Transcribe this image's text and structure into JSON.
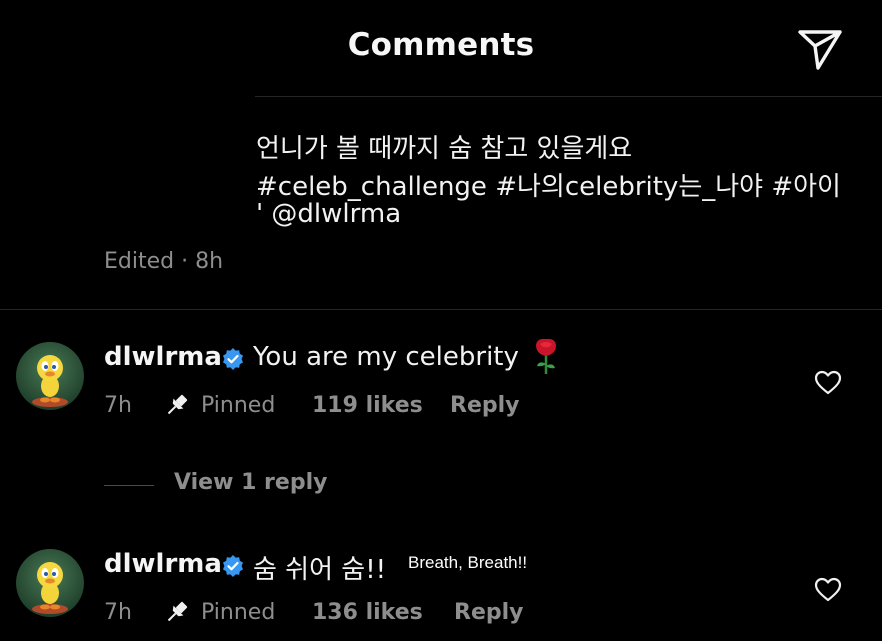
{
  "header": {
    "title": "Comments",
    "share_icon": "send-icon"
  },
  "caption": {
    "line1": "언니가 볼 때까지 숨 참고 있을게요",
    "line2": "#celeb_challenge #나의celebrity는_나야  #아이",
    "line3": "' @dlwlrma",
    "edited": "Edited · 8h"
  },
  "comments": [
    {
      "username": "dlwlrma",
      "text": "You are my celebrity",
      "emoji": "rose-emoji",
      "time": "7h",
      "pinned": "Pinned",
      "likes": "119 likes",
      "reply": "Reply"
    },
    {
      "username": "dlwlrma",
      "text": "숨 쉬어 숨!!",
      "time": "7h",
      "pinned": "Pinned",
      "likes": "136 likes",
      "reply": "Reply"
    }
  ],
  "view_replies": "View 1 reply",
  "translation_overlay": "Breath, Breath!!",
  "colors": {
    "background": "#000000",
    "text": "#f5f5f5",
    "secondary": "#8e8e8e",
    "verified": "#3897f0",
    "divider": "#262626"
  }
}
